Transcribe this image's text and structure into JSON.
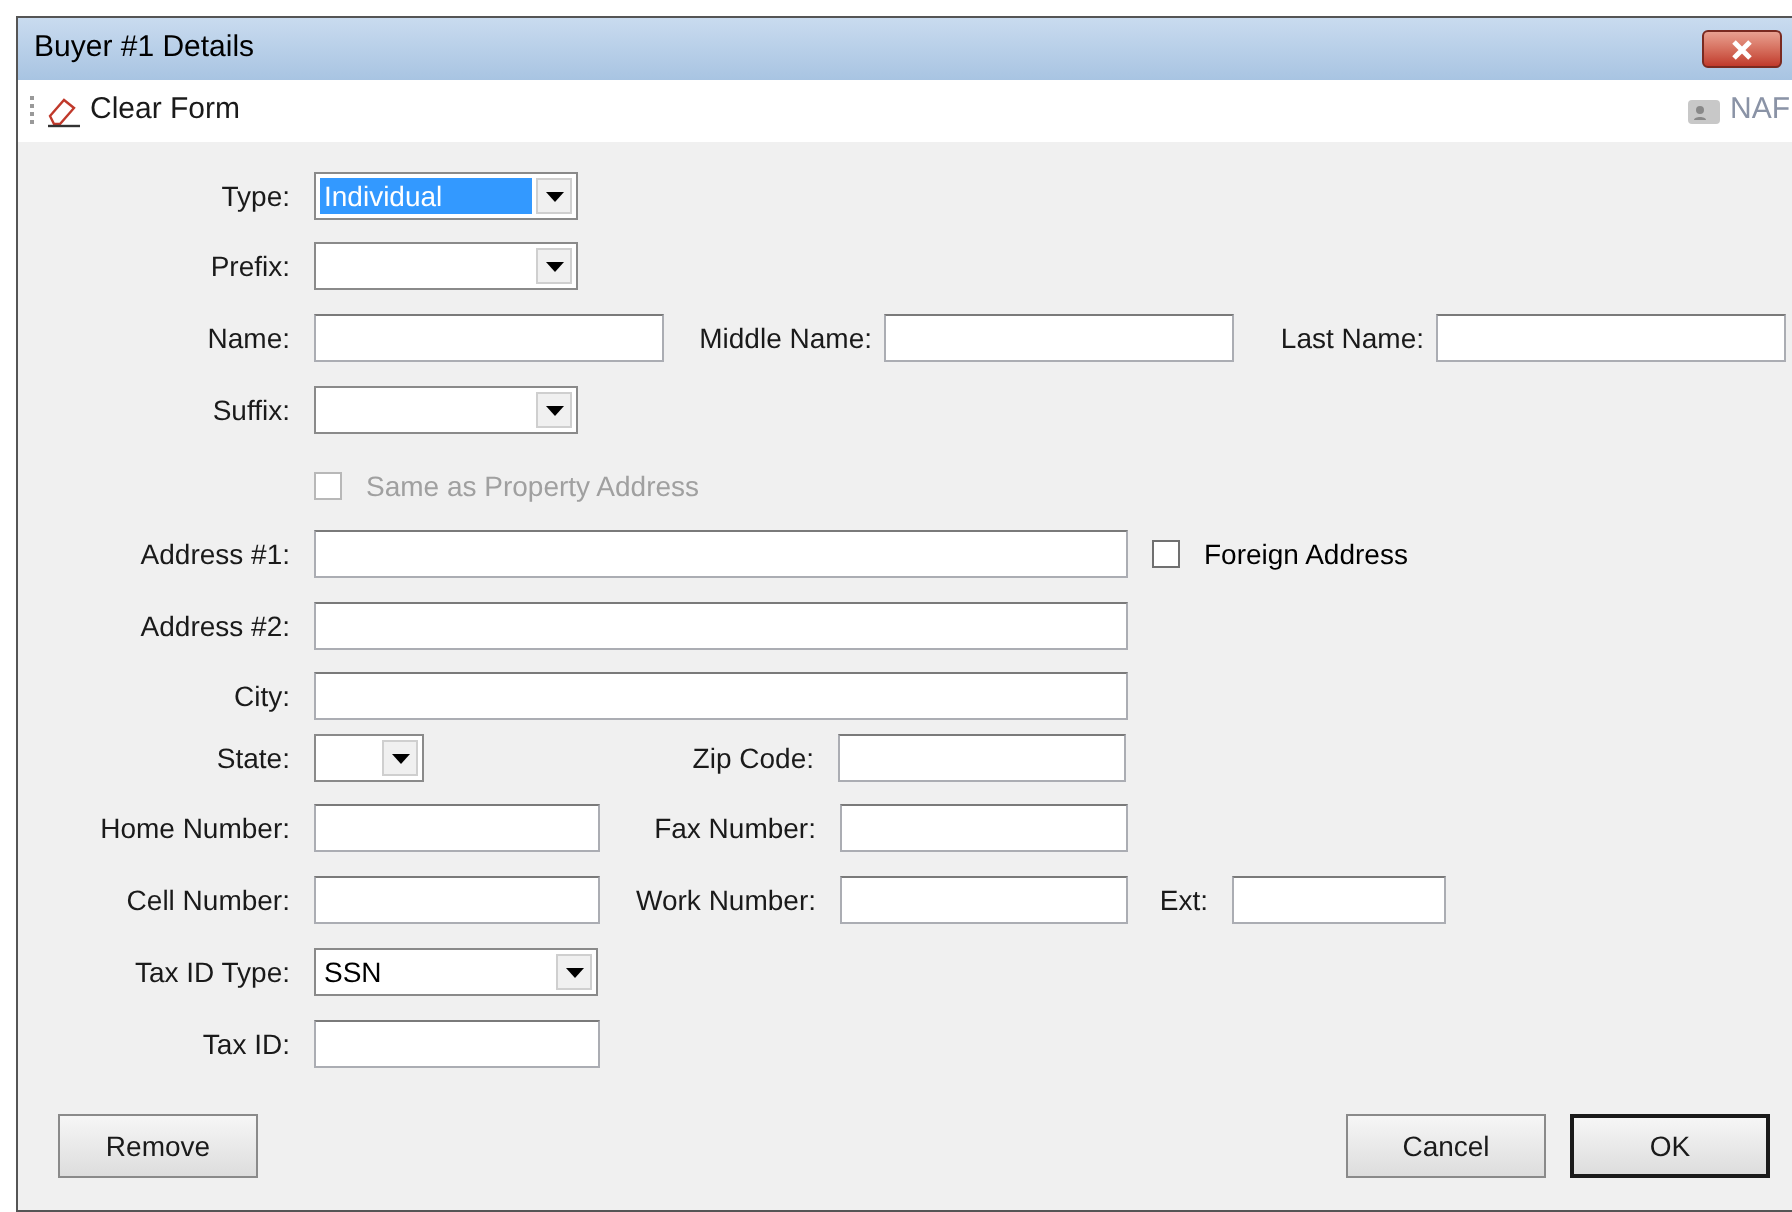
{
  "window": {
    "title": "Buyer #1 Details"
  },
  "toolbar": {
    "clear_form": "Clear Form",
    "naf": "NAF"
  },
  "type": {
    "label": "Type:",
    "value": "Individual",
    "highlighted": true
  },
  "prefix": {
    "label": "Prefix:"
  },
  "name": {
    "label": "Name:"
  },
  "middle_name": {
    "label": "Middle Name:"
  },
  "last_name": {
    "label": "Last Name:"
  },
  "suffix": {
    "label": "Suffix:"
  },
  "same_as_property": {
    "label": "Same as Property Address",
    "checked": false,
    "disabled": true
  },
  "address1": {
    "label": "Address #1:"
  },
  "foreign_address": {
    "label": "Foreign Address",
    "checked": false,
    "disabled": false
  },
  "address2": {
    "label": "Address #2:"
  },
  "city": {
    "label": "City:"
  },
  "state": {
    "label": "State:"
  },
  "zip_code": {
    "label": "Zip Code:"
  },
  "home_number": {
    "label": "Home Number:"
  },
  "fax_number": {
    "label": "Fax Number:"
  },
  "cell_number": {
    "label": "Cell Number:"
  },
  "work_number": {
    "label": "Work Number:"
  },
  "ext": {
    "label": "Ext:"
  },
  "tax_id_type": {
    "label": "Tax ID Type:",
    "value": "SSN"
  },
  "tax_id": {
    "label": "Tax ID:"
  },
  "buttons": {
    "remove": "Remove",
    "cancel": "Cancel",
    "ok": {
      "label": "OK",
      "default": true
    }
  }
}
